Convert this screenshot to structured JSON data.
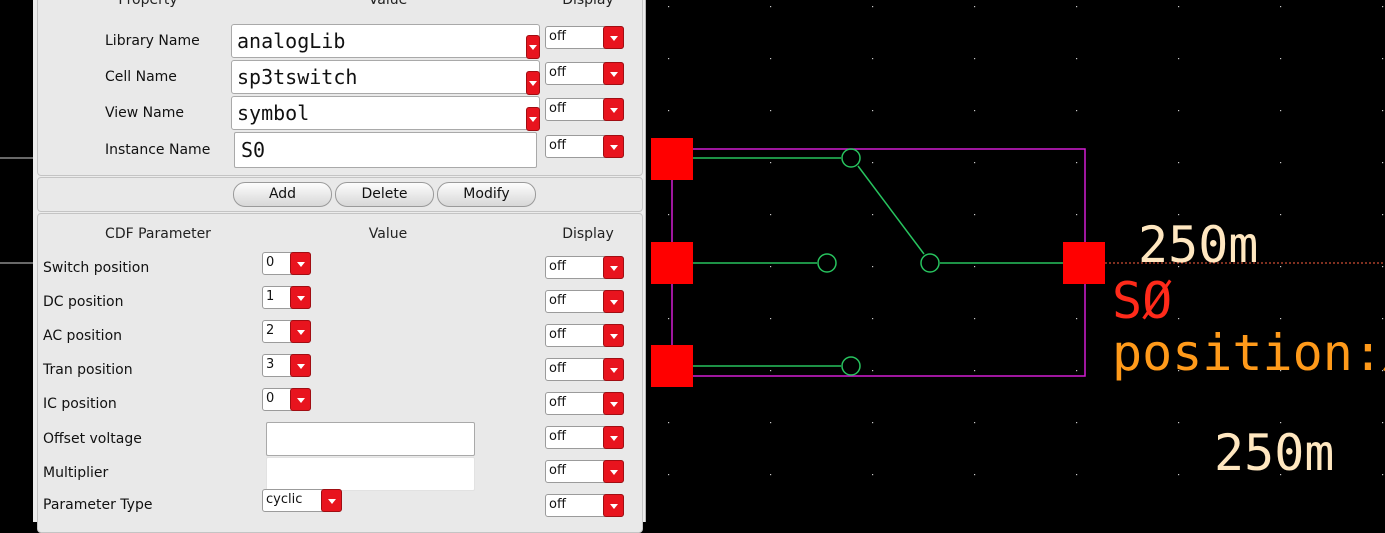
{
  "properties": {
    "headers": {
      "property": "Property",
      "value": "Value",
      "display": "Display"
    },
    "rows": [
      {
        "label": "Library Name",
        "value": "analogLib",
        "display": "off"
      },
      {
        "label": "Cell Name",
        "value": "sp3tswitch",
        "display": "off"
      },
      {
        "label": "View Name",
        "value": "symbol",
        "display": "off"
      },
      {
        "label": "Instance Name",
        "value": "S0",
        "display": "off"
      }
    ]
  },
  "buttons": {
    "add": "Add",
    "delete": "Delete",
    "modify": "Modify"
  },
  "cdf": {
    "headers": {
      "parameter": "CDF Parameter",
      "value": "Value",
      "display": "Display"
    },
    "rows": [
      {
        "label": "Switch position",
        "value": "0",
        "display": "off"
      },
      {
        "label": "DC position",
        "value": "1",
        "display": "off"
      },
      {
        "label": "AC position",
        "value": "2",
        "display": "off"
      },
      {
        "label": "Tran position",
        "value": "3",
        "display": "off"
      },
      {
        "label": "IC position",
        "value": "0",
        "display": "off"
      },
      {
        "label": "Offset voltage",
        "value": "",
        "display": "off"
      },
      {
        "label": "Multiplier",
        "value": "",
        "display": "off"
      },
      {
        "label": "Parameter Type",
        "value": "cyclic",
        "display": "off"
      }
    ]
  },
  "schematic": {
    "labels": {
      "top_value": "250m",
      "instance": "SØ",
      "position": "position:Ø",
      "bottom_value": "250m"
    },
    "colors": {
      "background": "#000000",
      "pin": "#ff0000",
      "box": "#d21ed2",
      "wire": "#27c35e",
      "instance_label": "#ff2a1a",
      "annotation": "#ff9a1a",
      "value_label": "#ffe7c0",
      "grid_dot": "#c8c8c8"
    }
  }
}
